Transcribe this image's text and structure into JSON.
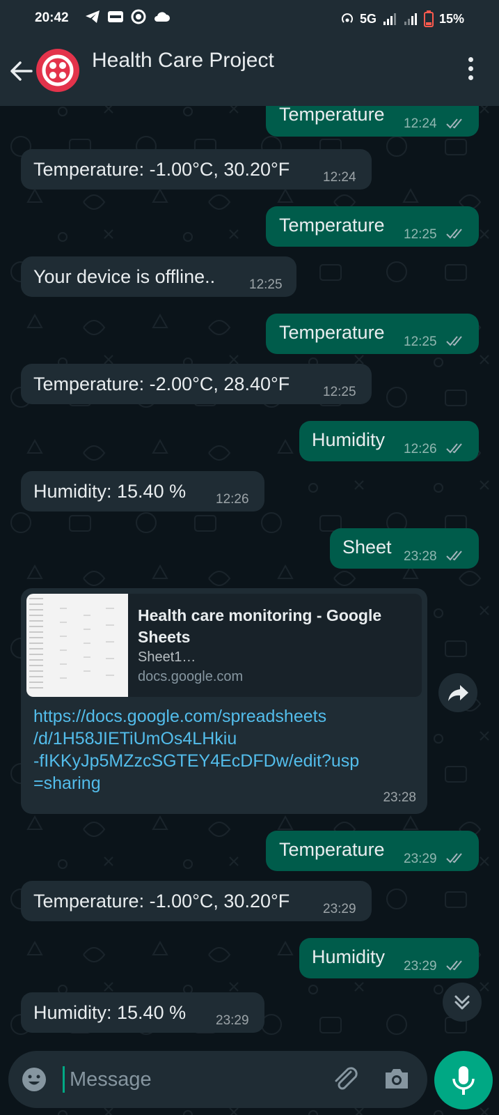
{
  "status_bar": {
    "time": "20:42",
    "network": "5G",
    "battery": "15%",
    "icons_left": [
      "telegram-icon",
      "paytm-icon",
      "circle-icon",
      "cloud-icon"
    ]
  },
  "header": {
    "title": "Health Care Project",
    "avatar_color": "#e3334b"
  },
  "messages": [
    {
      "dir": "out",
      "text": "Temperature",
      "time": "12:24"
    },
    {
      "dir": "in",
      "text": "Temperature: -1.00°C, 30.20°F",
      "time": "12:24"
    },
    {
      "dir": "out",
      "text": "Temperature",
      "time": "12:25"
    },
    {
      "dir": "in",
      "text": "Your device is offline..",
      "time": "12:25"
    },
    {
      "dir": "out",
      "text": "Temperature",
      "time": "12:25"
    },
    {
      "dir": "in",
      "text": "Temperature: -2.00°C, 28.40°F",
      "time": "12:25"
    },
    {
      "dir": "out",
      "text": "Humidity",
      "time": "12:26"
    },
    {
      "dir": "in",
      "text": "Humidity: 15.40 %",
      "time": "12:26"
    },
    {
      "dir": "out",
      "text": "Sheet",
      "time": "23:28"
    },
    {
      "dir": "out",
      "text": "Temperature",
      "time": "23:29"
    },
    {
      "dir": "in",
      "text": "Temperature: -1.00°C, 30.20°F",
      "time": "23:29"
    },
    {
      "dir": "out",
      "text": "Humidity",
      "time": "23:29"
    },
    {
      "dir": "in",
      "text": "Humidity: 15.40 %",
      "time": "23:29"
    }
  ],
  "link_message": {
    "preview_title": "Health care monitoring - Google Sheets",
    "preview_subtitle": "Sheet1…",
    "preview_domain": "docs.google.com",
    "link_text": "https://docs.google.com/spreadsheets\n/d/1H58JIETiUmOs4LHkiu\n-fIKKyJp5MZzcSGTEY4EcDFDw/edit?usp\n=sharing",
    "time": "23:28"
  },
  "input": {
    "placeholder": "Message"
  },
  "colors": {
    "background": "#0b141a",
    "header": "#1f2c34",
    "outgoing_bubble": "#005c4b",
    "incoming_bubble": "#1f2c34",
    "accent": "#00a884",
    "link": "#53bdeb",
    "read_ticks": "#a6b5bd"
  }
}
